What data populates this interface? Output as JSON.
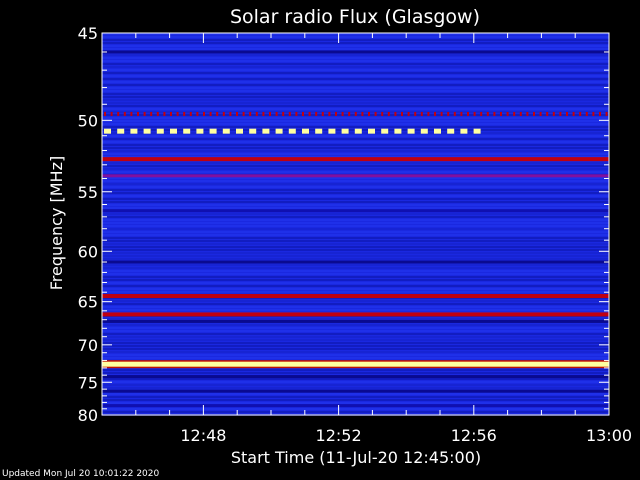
{
  "chart_data": {
    "type": "heatmap",
    "title": "Solar radio Flux (Glasgow)",
    "xlabel": "Start Time (11-Jul-20 12:45:00)",
    "ylabel": "Frequency [MHz]",
    "x_ticks": [
      "12:48",
      "12:52",
      "12:56",
      "13:00"
    ],
    "x_range": [
      "12:45",
      "13:00"
    ],
    "y_ticks": [
      45,
      50,
      55,
      60,
      65,
      70,
      75,
      80
    ],
    "y_range": [
      45,
      80
    ],
    "y_scale": "reciprocal",
    "colormap": [
      "#0000a0",
      "#1a1aff",
      "#3030ff",
      "#c00000",
      "#ff4000",
      "#ffff80",
      "#ffffff"
    ],
    "background_color": "#1a28e0",
    "bands": [
      {
        "freq_mhz": 46.0,
        "intensity": 0.15
      },
      {
        "freq_mhz": 49.6,
        "intensity": 0.55,
        "dashed": true
      },
      {
        "freq_mhz": 50.7,
        "intensity": 0.95,
        "dashed": true,
        "end_time": "12:56"
      },
      {
        "freq_mhz": 52.6,
        "intensity": 0.6
      },
      {
        "freq_mhz": 53.8,
        "intensity": 0.3
      },
      {
        "freq_mhz": 56.5,
        "intensity": 0.1
      },
      {
        "freq_mhz": 61.0,
        "intensity": 0.12
      },
      {
        "freq_mhz": 64.4,
        "intensity": 0.62
      },
      {
        "freq_mhz": 66.4,
        "intensity": 0.5
      },
      {
        "freq_mhz": 67.2,
        "intensity": 0.15
      },
      {
        "freq_mhz": 72.5,
        "intensity": 1.0
      },
      {
        "freq_mhz": 74.2,
        "intensity": 0.2
      },
      {
        "freq_mhz": 76.3,
        "intensity": 0.12
      },
      {
        "freq_mhz": 78.5,
        "intensity": 0.1
      }
    ]
  },
  "footer": "Updated Mon Jul 20 10:01:22 2020"
}
